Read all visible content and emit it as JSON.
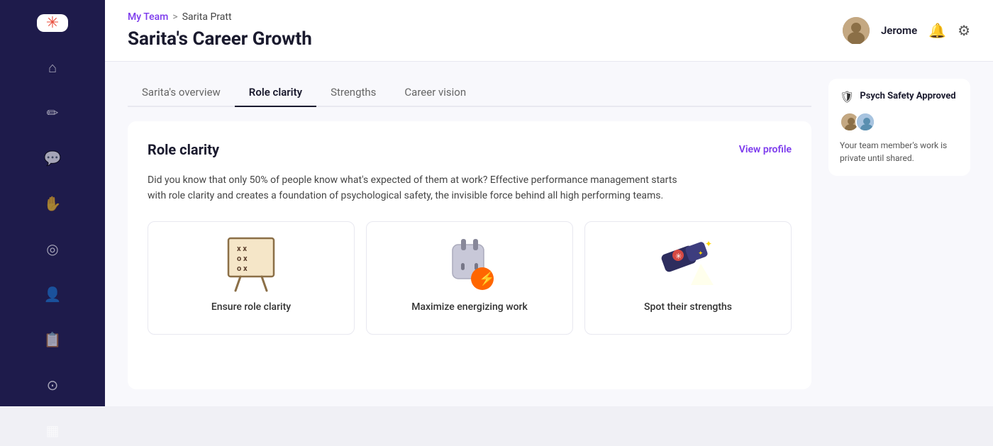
{
  "sidebar": {
    "logo": "✳",
    "nav_items": [
      {
        "name": "home",
        "icon": "⌂",
        "active": false
      },
      {
        "name": "edit",
        "icon": "✏",
        "active": false
      },
      {
        "name": "chat",
        "icon": "💬",
        "active": false
      },
      {
        "name": "hand",
        "icon": "✋",
        "active": false
      },
      {
        "name": "target",
        "icon": "◎",
        "active": false
      },
      {
        "name": "person",
        "icon": "👤",
        "active": false
      },
      {
        "name": "clipboard",
        "icon": "📋",
        "active": false
      },
      {
        "name": "settings-circle",
        "icon": "⊙",
        "active": false
      },
      {
        "name": "chart",
        "icon": "▦",
        "active": false
      }
    ]
  },
  "header": {
    "breadcrumb": {
      "team_link": "My Team",
      "separator": ">",
      "current": "Sarita Pratt"
    },
    "page_title": "Sarita's Career Growth",
    "user": {
      "name": "Jerome"
    }
  },
  "tabs": [
    {
      "label": "Sarita's overview",
      "active": false
    },
    {
      "label": "Role clarity",
      "active": true
    },
    {
      "label": "Strengths",
      "active": false
    },
    {
      "label": "Career vision",
      "active": false
    }
  ],
  "role_clarity_card": {
    "title": "Role clarity",
    "view_profile_label": "View profile",
    "description": "Did you know that only 50% of people know what's expected of them at work? Effective performance management starts with role clarity and creates a foundation of psychological safety, the invisible force behind all high performing teams.",
    "features": [
      {
        "label": "Ensure role clarity",
        "icon_type": "strategy-board"
      },
      {
        "label": "Maximize energizing work",
        "icon_type": "plug"
      },
      {
        "label": "Spot their strengths",
        "icon_type": "spotlight"
      }
    ]
  },
  "psych_safety_panel": {
    "title": "Psych Safety Approved",
    "description": "Your team member's work is private until shared."
  }
}
